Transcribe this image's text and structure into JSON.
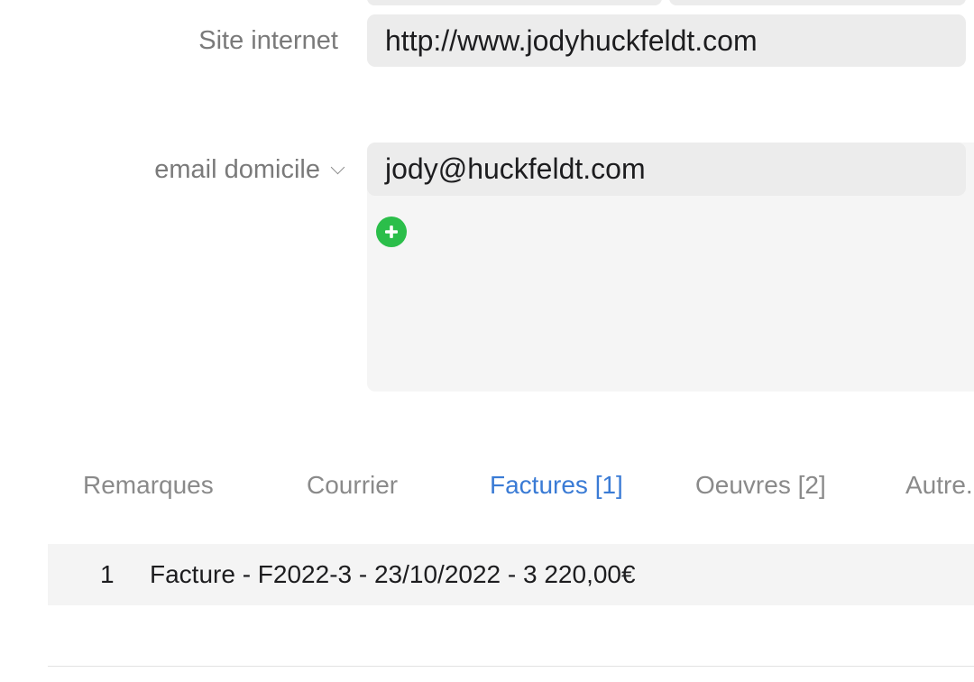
{
  "fields": {
    "website": {
      "label": "Site internet",
      "value": "http://www.jodyhuckfeldt.com"
    },
    "email": {
      "label": "email domicile",
      "value": "jody@huckfeldt.com"
    }
  },
  "tabs": [
    {
      "label": "Remarques",
      "active": false
    },
    {
      "label": "Courrier",
      "active": false
    },
    {
      "label": "Factures [1]",
      "active": true
    },
    {
      "label": "Oeuvres [2]",
      "active": false
    },
    {
      "label": "Autre...",
      "active": false
    }
  ],
  "invoices": [
    {
      "index": "1",
      "text": "Facture - F2022-3 - 23/10/2022 - 3 220,00€"
    }
  ],
  "colors": {
    "accent": "#3a7bd5",
    "add_button": "#2bbe4a",
    "field_bg": "#ececec"
  },
  "icons": {
    "email_type_dropdown": "chevron-down-icon",
    "add_email": "plus-icon"
  }
}
